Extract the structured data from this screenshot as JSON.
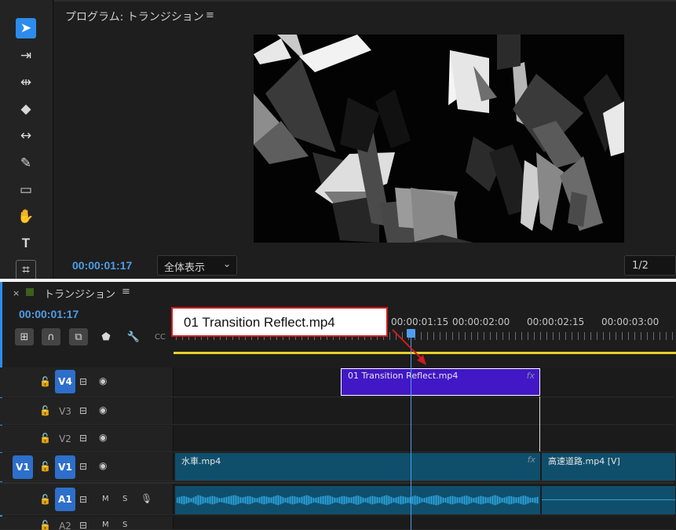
{
  "program": {
    "title": "プログラム: トランジション",
    "timecode": "00:00:01:17",
    "zoom_value": "全体表示",
    "resolution_value": "1/2"
  },
  "tools": [
    {
      "name": "selection-tool-icon",
      "glyph": "➤"
    },
    {
      "name": "track-select-forward-icon",
      "glyph": "⇥"
    },
    {
      "name": "ripple-edit-icon",
      "glyph": "⇹"
    },
    {
      "name": "razor-icon",
      "glyph": "◆"
    },
    {
      "name": "slip-icon",
      "glyph": "↔"
    },
    {
      "name": "pen-icon",
      "glyph": "✎"
    },
    {
      "name": "rectangle-icon",
      "glyph": "▭"
    },
    {
      "name": "hand-icon",
      "glyph": "✋"
    },
    {
      "name": "type-icon",
      "glyph": "T"
    },
    {
      "name": "remix-icon",
      "glyph": "⌗"
    }
  ],
  "timeline": {
    "close": "×",
    "title": "トランジション",
    "timecode": "00:00:01:17",
    "ruler_labels": [
      "00:00:01:15",
      "00:00:02:00",
      "00:00:02:15",
      "00:00:03:00"
    ],
    "menu": "≡"
  },
  "tracks": {
    "v4": {
      "target": "V4"
    },
    "v3": {
      "target": "V3"
    },
    "v2": {
      "target": "V2"
    },
    "v1": {
      "source": "V1",
      "target": "V1"
    },
    "a1": {
      "target": "A1",
      "mute": "M",
      "solo": "S"
    },
    "a2": {
      "target": "A2",
      "mute": "M",
      "solo": "S"
    }
  },
  "clips": {
    "transition": {
      "label": "01 Transition Reflect.mp4",
      "fx": "fx"
    },
    "water": {
      "label": "水車.mp4",
      "fx": "fx"
    },
    "highway": {
      "label": "高速道路.mp4 [V]"
    }
  },
  "callout": {
    "text": "01 Transition Reflect.mp4"
  },
  "menu_glyph": "≡",
  "colors": {
    "accent": "#2d8ceb",
    "clip_purple": "#4217c6",
    "clip_teal": "#0f4f6b",
    "work_area": "#e7d12a",
    "callout_border": "#d11c1c"
  }
}
